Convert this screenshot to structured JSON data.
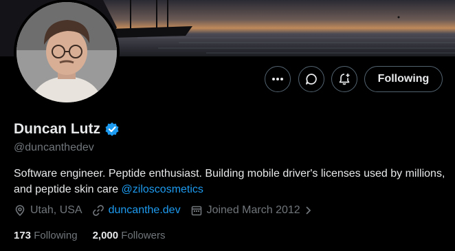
{
  "profile": {
    "name": "Duncan Lutz",
    "handle": "@duncanthedev",
    "bio_text": "Software engineer. Peptide enthusiast. Building mobile driver's licenses used by millions, and peptide skin care ",
    "bio_mention": "@ziloscosmetics",
    "location": "Utah, USA",
    "website": "duncanthe.dev",
    "joined": "Joined March 2012",
    "following_count": "173",
    "following_label": "Following",
    "followers_count": "2,000",
    "followers_label": "Followers"
  },
  "actions": {
    "following_button": "Following"
  },
  "colors": {
    "accent": "#1d9bf0",
    "muted": "#71767b",
    "text": "#e7e9ea",
    "border": "#536471",
    "background": "#000000"
  },
  "icons": {
    "more": "more-icon",
    "message": "message-icon",
    "notify": "notification-bell-icon",
    "verified": "verified-badge-icon",
    "location": "location-pin-icon",
    "link": "link-icon",
    "calendar": "calendar-icon",
    "chevron": "chevron-right-icon"
  }
}
